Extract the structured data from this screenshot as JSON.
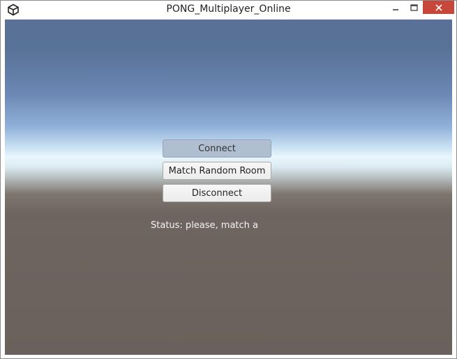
{
  "window": {
    "title": "PONG_Multiplayer_Online",
    "icon": "unity-icon"
  },
  "controls": {
    "minimize_icon": "minimize-icon",
    "maximize_icon": "maximize-icon",
    "close_icon": "close-icon"
  },
  "menu": {
    "connect_label": "Connect",
    "match_label": "Match Random Room",
    "disconnect_label": "Disconnect"
  },
  "status": {
    "text": "Status: please, match a"
  },
  "colors": {
    "close_button": "#c7483a",
    "disabled_button": "#b0bed1",
    "sky_top": "#5b7197",
    "horizon": "#eaf7fd",
    "ground": "#6b615c"
  }
}
